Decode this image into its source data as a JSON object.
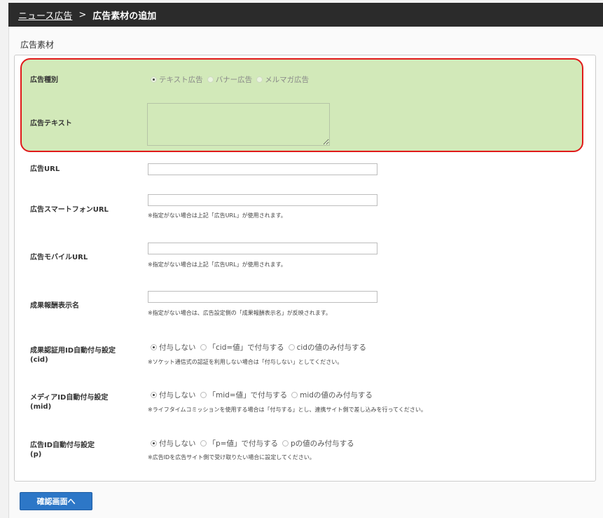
{
  "breadcrumb": {
    "parent": "ニュース広告",
    "separator": ">",
    "current": "広告素材の追加"
  },
  "section_title": "広告素材",
  "form": {
    "ad_type": {
      "label": "広告種別",
      "options": [
        "テキスト広告",
        "バナー広告",
        "メルマガ広告"
      ],
      "selected": "テキスト広告"
    },
    "ad_text": {
      "label": "広告テキスト",
      "value": ""
    },
    "ad_url": {
      "label": "広告URL",
      "value": ""
    },
    "smartphone_url": {
      "label": "広告スマートフォンURL",
      "value": "",
      "note": "※指定がない場合は上記「広告URL」が使用されます。"
    },
    "mobile_url": {
      "label": "広告モバイルURL",
      "value": "",
      "note": "※指定がない場合は上記「広告URL」が使用されます。"
    },
    "reward_name": {
      "label": "成果報酬表示名",
      "value": "",
      "note": "※指定がない場合は、広告設定側の「成果報酬表示名」が反映されます。"
    },
    "cid_setting": {
      "label_line1": "成果認証用ID自動付与設定",
      "label_line2": "(cid)",
      "options": [
        "付与しない",
        "「cid=値」で付与する",
        "cidの値のみ付与する"
      ],
      "selected": "付与しない",
      "note": "※ソケット通信式の認証を利用しない場合は「付与しない」としてください。"
    },
    "mid_setting": {
      "label_line1": "メディアID自動付与設定",
      "label_line2": "(mid)",
      "options": [
        "付与しない",
        "「mid=値」で付与する",
        "midの値のみ付与する"
      ],
      "selected": "付与しない",
      "note": "※ライフタイムコミッションを使用する場合は「付与する」とし、連携サイト側で差し込みを行ってください。"
    },
    "p_setting": {
      "label_line1": "広告ID自動付与設定",
      "label_line2": "(p)",
      "options": [
        "付与しない",
        "「p=値」で付与する",
        "pの値のみ付与する"
      ],
      "selected": "付与しない",
      "note": "※広告IDを広告サイト側で受け取りたい場合に設定してください。"
    }
  },
  "confirm_button": "確認画面へ",
  "colors": {
    "header_bg": "#2b2b2b",
    "highlight_bg": "#d2e9b9",
    "highlight_border": "#e01a1a",
    "button_bg": "#2d77c7"
  }
}
